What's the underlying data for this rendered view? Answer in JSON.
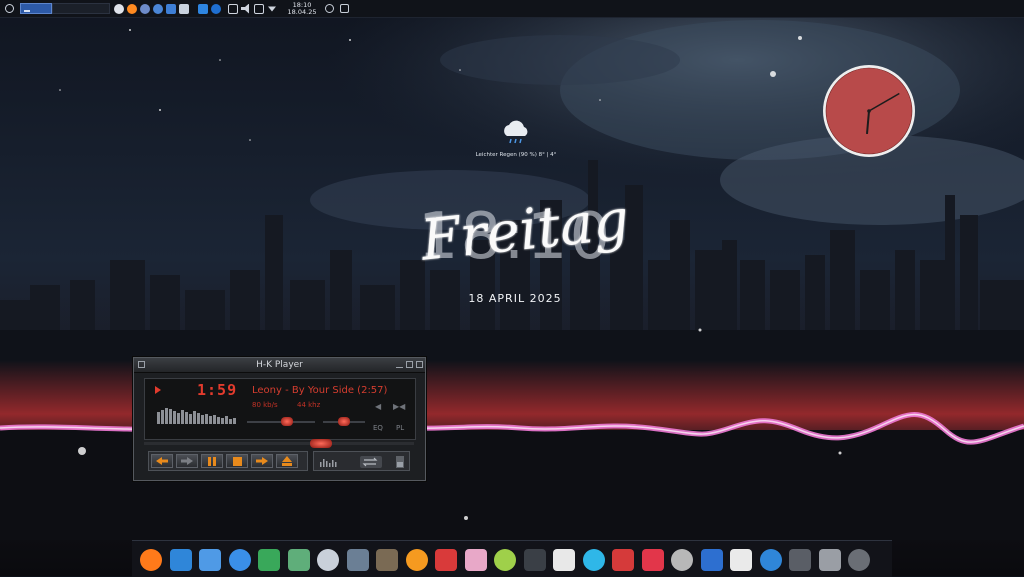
{
  "top_panel": {
    "clock_time": "18:10",
    "clock_date": "18.04.25",
    "tray_icons": [
      "steam-icon",
      "firefox-icon",
      "settings-icon",
      "chromium-icon",
      "file-manager-icon",
      "monitor-icon",
      "windows-icon",
      "hp-icon",
      "clipboard-icon",
      "volume-icon",
      "display-icon",
      "dropdown-icon"
    ],
    "accent": "#2d5aa8"
  },
  "weather": {
    "icon": "cloud-rain-icon",
    "text": "Leichter Regen (90 %) 8° | 4°"
  },
  "desktop": {
    "big_time": "18:10",
    "day_name": "Freitag",
    "date": "18 APRIL 2025"
  },
  "analog_clock": {
    "hours": 18,
    "minutes": 10,
    "face_color": "#b84a4a"
  },
  "player": {
    "title": "H-K Player",
    "time": "1:59",
    "song": "Leony - By Your Side (2:57)",
    "bitrate": "80 kb/s",
    "samplerate": "44 khz",
    "eq_label": "EQ",
    "pl_label": "PL",
    "progress": 0.67,
    "volume": 0.6,
    "balance": 0.5,
    "display_color": "#e23b2d"
  },
  "dock": {
    "apps": [
      "firefox-icon",
      "thunderbird-icon",
      "files-icon",
      "writer-icon",
      "calc-icon",
      "dino-icon",
      "computer-icon",
      "settings-icon",
      "gimp-icon",
      "vlc-icon",
      "filezilla-icon",
      "lollypop-icon",
      "gem-icon",
      "camera-icon",
      "music-icon",
      "remote-icon",
      "ring-icon",
      "strawberry-icon",
      "settings-wheel-icon",
      "audio-icon",
      "clapper-icon",
      "browser-icon",
      "terminal-icon",
      "archive-icon",
      "clock-icon"
    ]
  }
}
